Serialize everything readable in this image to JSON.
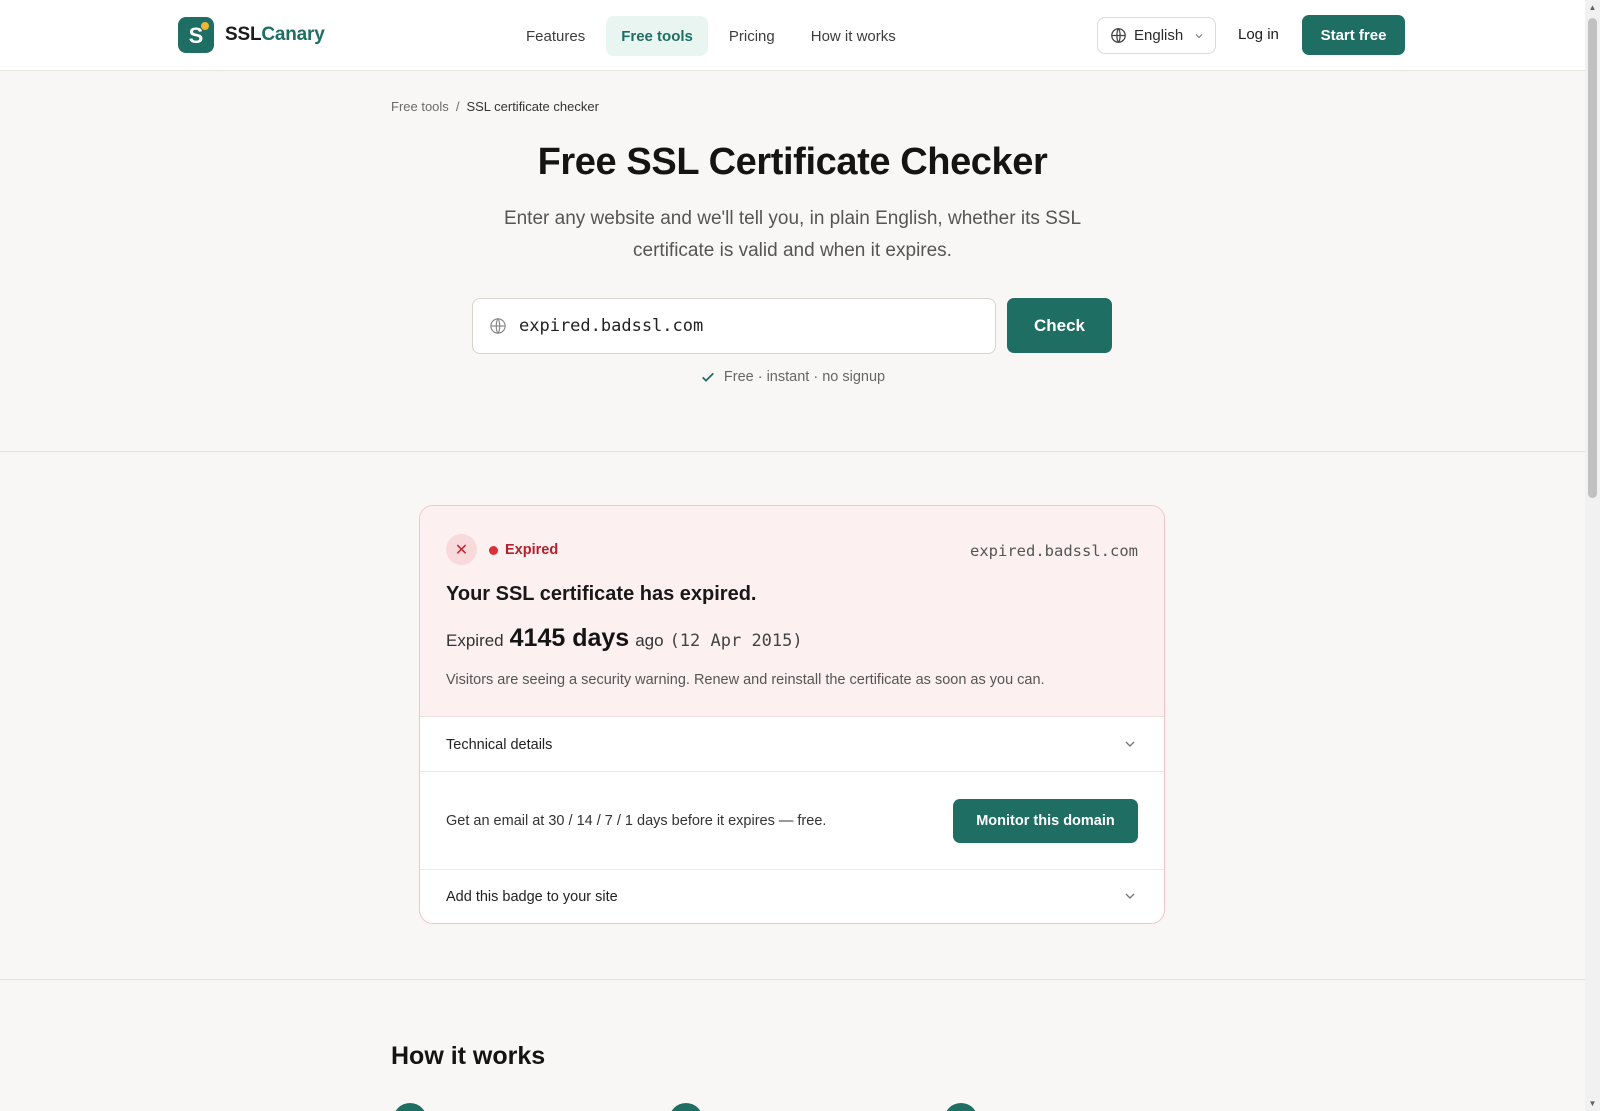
{
  "header": {
    "brand_prefix": "SSL",
    "brand_suffix": "Canary",
    "brand_mark_letter": "S",
    "nav": [
      {
        "label": "Features"
      },
      {
        "label": "Free tools"
      },
      {
        "label": "Pricing"
      },
      {
        "label": "How it works"
      }
    ],
    "language": "English",
    "login_label": "Log in",
    "start_label": "Start free"
  },
  "breadcrumb": {
    "parent": "Free tools",
    "separator": "/",
    "current": "SSL certificate checker"
  },
  "hero": {
    "title": "Free SSL Certificate Checker",
    "subtitle": "Enter any website and we'll tell you, in plain English, whether its SSL certificate is valid and when it expires.",
    "input_value": "expired.badssl.com",
    "check_label": "Check",
    "hint": "Free · instant · no signup"
  },
  "result": {
    "status": "Expired",
    "domain": "expired.badssl.com",
    "title": "Your SSL certificate has expired.",
    "expired_prefix": "Expired",
    "expired_days": "4145 days",
    "expired_suffix": "ago",
    "expired_date": "(12 Apr 2015)",
    "warning": "Visitors are seeing a security warning. Renew and reinstall the certificate as soon as you can.",
    "technical_details_label": "Technical details",
    "monitor_text": "Get an email at 30 / 14 / 7 / 1 days before it expires — free.",
    "monitor_button": "Monitor this domain",
    "badge_label": "Add this badge to your site"
  },
  "how_it_works": {
    "title": "How it works"
  },
  "colors": {
    "brand": "#1e6e63",
    "accent": "#f2b632",
    "error": "#c62832",
    "error_bg": "#fdf0f1"
  }
}
